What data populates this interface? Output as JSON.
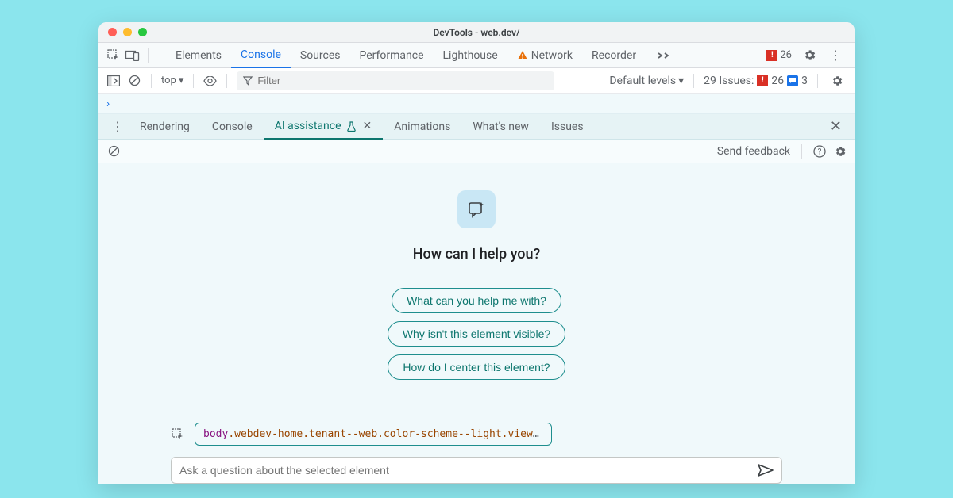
{
  "window": {
    "title": "DevTools - web.dev/"
  },
  "mainTabs": {
    "items": [
      {
        "label": "Elements",
        "active": false
      },
      {
        "label": "Console",
        "active": true
      },
      {
        "label": "Sources",
        "active": false
      },
      {
        "label": "Performance",
        "active": false
      },
      {
        "label": "Lighthouse",
        "active": false
      },
      {
        "label": "Network",
        "active": false,
        "warn": true
      },
      {
        "label": "Recorder",
        "active": false
      }
    ],
    "errorCount": "26"
  },
  "consoleBar": {
    "context": "top",
    "filterPlaceholder": "Filter",
    "levels": "Default levels",
    "issuesLabel": "29 Issues:",
    "issuesErr": "26",
    "issuesMsg": "3"
  },
  "drawer": {
    "tabs": [
      {
        "label": "Rendering"
      },
      {
        "label": "Console"
      },
      {
        "label": "AI assistance",
        "active": true,
        "flask": true,
        "closable": true
      },
      {
        "label": "Animations"
      },
      {
        "label": "What's new"
      },
      {
        "label": "Issues"
      }
    ],
    "feedback": "Send feedback"
  },
  "ai": {
    "heading": "How can I help you?",
    "suggestions": [
      "What can you help me with?",
      "Why isn't this element visible?",
      "How do I center this element?"
    ],
    "elementTag": "body",
    "elementClasses": ".webdev-home.tenant--web.color-scheme--light.viewport-…",
    "placeholder": "Ask a question about the selected element"
  }
}
